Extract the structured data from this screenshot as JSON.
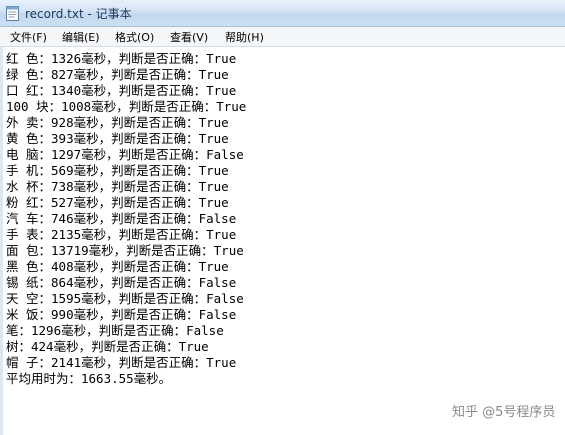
{
  "window": {
    "title": "record.txt - 记事本"
  },
  "menu": {
    "items": [
      "文件(F)",
      "编辑(E)",
      "格式(O)",
      "查看(V)",
      "帮助(H)"
    ]
  },
  "document": {
    "lines": [
      "红 色：1326毫秒，判断是否正确：True",
      "绿 色：827毫秒，判断是否正确：True",
      "口 红：1340毫秒，判断是否正确：True",
      "100 块：1008毫秒，判断是否正确：True",
      "外 卖：928毫秒，判断是否正确：True",
      "黄 色：393毫秒，判断是否正确：True",
      "电 脑：1297毫秒，判断是否正确：False",
      "手 机：569毫秒，判断是否正确：True",
      "水 杯：738毫秒，判断是否正确：True",
      "粉 红：527毫秒，判断是否正确：True",
      "汽 车：746毫秒，判断是否正确：False",
      "手 表：2135毫秒，判断是否正确：True",
      "面 包：13719毫秒，判断是否正确：True",
      "黑 色：408毫秒，判断是否正确：True",
      "锡 纸：864毫秒，判断是否正确：False",
      "天 空：1595毫秒，判断是否正确：False",
      "米 饭：990毫秒，判断是否正确：False",
      "笔：1296毫秒，判断是否正确：False",
      "树：424毫秒，判断是否正确：True",
      "帽 子：2141毫秒，判断是否正确：True",
      "平均用时为：1663.55毫秒。"
    ]
  },
  "watermark": {
    "text": "知乎 @5号程序员"
  },
  "icons": {
    "app": "notepad-icon"
  }
}
